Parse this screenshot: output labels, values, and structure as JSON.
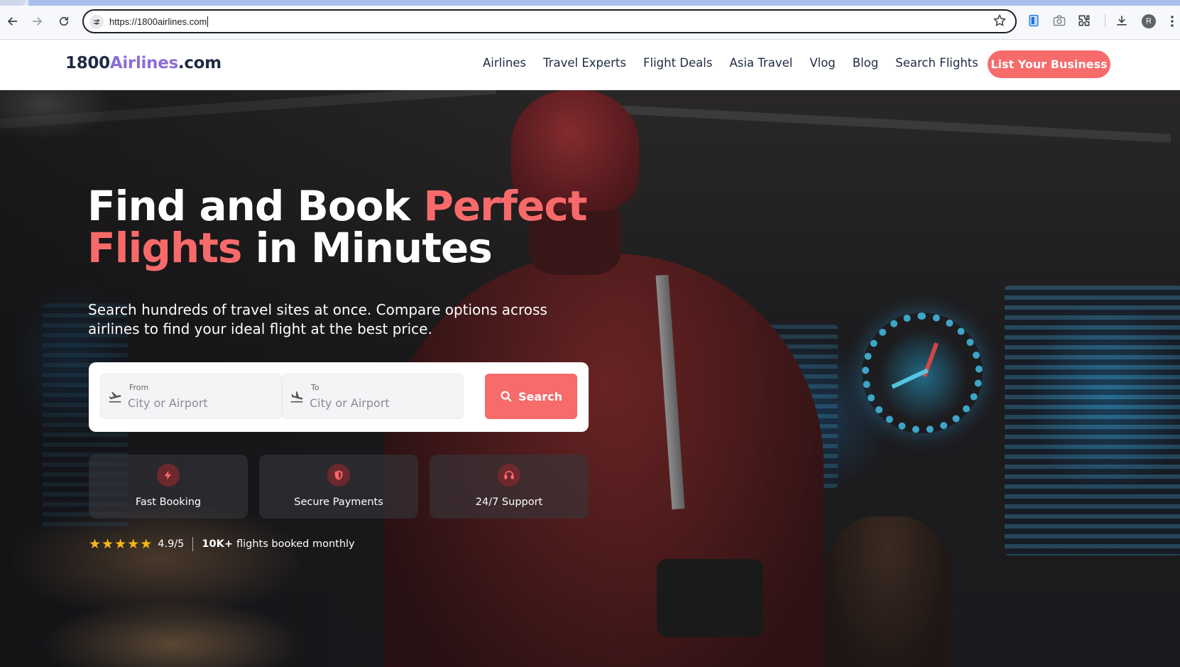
{
  "browser": {
    "url": "https://1800airlines.com",
    "profile_initial": "R",
    "icons": [
      "back-icon",
      "forward-icon",
      "reload-icon",
      "site-info-icon",
      "bookmark-star-icon",
      "reading-mode-icon",
      "screenshot-icon",
      "extensions-icon",
      "download-icon",
      "more-icon"
    ]
  },
  "header": {
    "logo_prefix": "1800",
    "logo_accent": "Airlines",
    "logo_suffix": ".com",
    "nav": [
      "Airlines",
      "Travel Experts",
      "Flight Deals",
      "Asia Travel",
      "Vlog",
      "Blog",
      "Search Flights"
    ],
    "cta_label": "List Your Business"
  },
  "hero": {
    "title_part1": "Find and Book ",
    "title_highlight1": "Perfect",
    "title_highlight2": "Flights",
    "title_part2": " in Minutes",
    "subtitle": "Search hundreds of travel sites at once. Compare options across airlines to find your ideal flight at the best price.",
    "search": {
      "from_label": "From",
      "from_placeholder": "City or Airport",
      "to_label": "To",
      "to_placeholder": "City or Airport",
      "button_label": "Search"
    },
    "features": [
      {
        "label": "Fast Booking",
        "icon": "lightning-bolt-icon"
      },
      {
        "label": "Secure Payments",
        "icon": "shield-icon"
      },
      {
        "label": "24/7 Support",
        "icon": "headset-icon"
      }
    ],
    "rating": {
      "stars": 5,
      "score": "4.9/5",
      "bookings_strong": "10K+",
      "bookings_text": "flights booked monthly"
    }
  },
  "colors": {
    "accent": "#f76b6b",
    "logo_accent": "#8b6fd6",
    "text_dark": "#1f2a44",
    "star": "#f5b915"
  }
}
